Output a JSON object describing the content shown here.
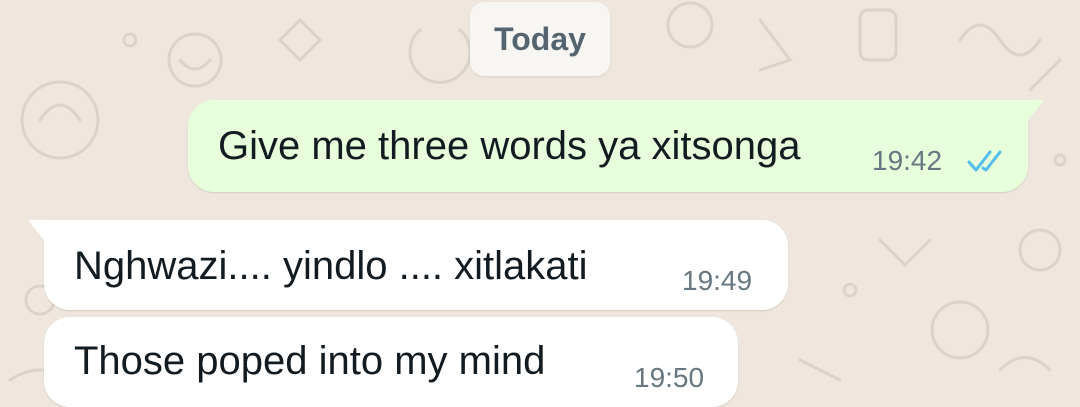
{
  "date_separator": "Today",
  "messages": [
    {
      "direction": "outgoing",
      "text": "Give me three words ya xitsonga",
      "time": "19:42",
      "status_icon": "double-check-read-icon"
    },
    {
      "direction": "incoming",
      "text": "Nghwazi.... yindlo .... xitlakati",
      "time": "19:49"
    },
    {
      "direction": "incoming",
      "text": "Those poped into my mind",
      "time": "19:50"
    }
  ],
  "colors": {
    "background": "#efe7de",
    "outgoing_bubble": "#e7ffdb",
    "incoming_bubble": "#ffffff",
    "read_ticks": "#53bdeb",
    "timestamp": "#667781"
  }
}
